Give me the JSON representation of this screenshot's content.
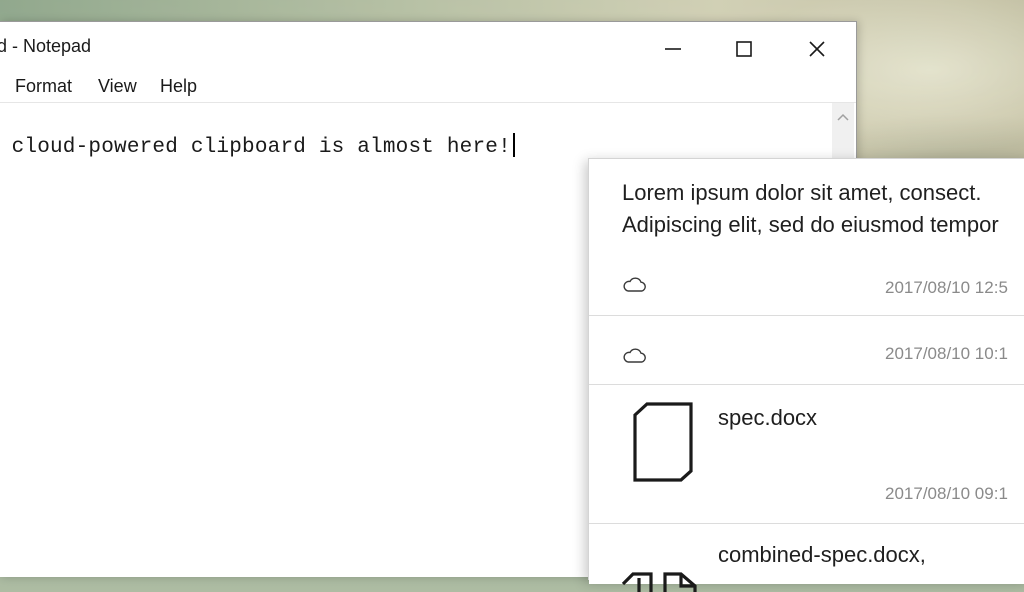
{
  "notepad": {
    "title": "ed - Notepad",
    "controls": {
      "minimize": "minimize-icon",
      "maximize": "maximize-icon",
      "close": "close-icon"
    },
    "menu": [
      "Format",
      "View",
      "Help"
    ],
    "content": "v cloud-powered clipboard is almost here!"
  },
  "clipboard_history": {
    "items": [
      {
        "type": "text",
        "text": "Lorem ipsum dolor sit amet, consect. Adipiscing elit, sed do eiusmod tempor",
        "icon": "cloud-icon",
        "timestamp": "2017/08/10 12:5"
      },
      {
        "type": "empty",
        "icon": "cloud-icon",
        "timestamp": "2017/08/10 10:1"
      },
      {
        "type": "file",
        "icon": "document-icon",
        "name": "spec.docx",
        "timestamp": "2017/08/10 09:1"
      },
      {
        "type": "files",
        "icon": "multiple-documents-icon",
        "name": "combined-spec.docx,"
      }
    ]
  },
  "colors": {
    "window": "#ffffff",
    "text": "#1a1a1a",
    "timestamp": "#8a8a8a",
    "divider": "#dcdcdc"
  }
}
